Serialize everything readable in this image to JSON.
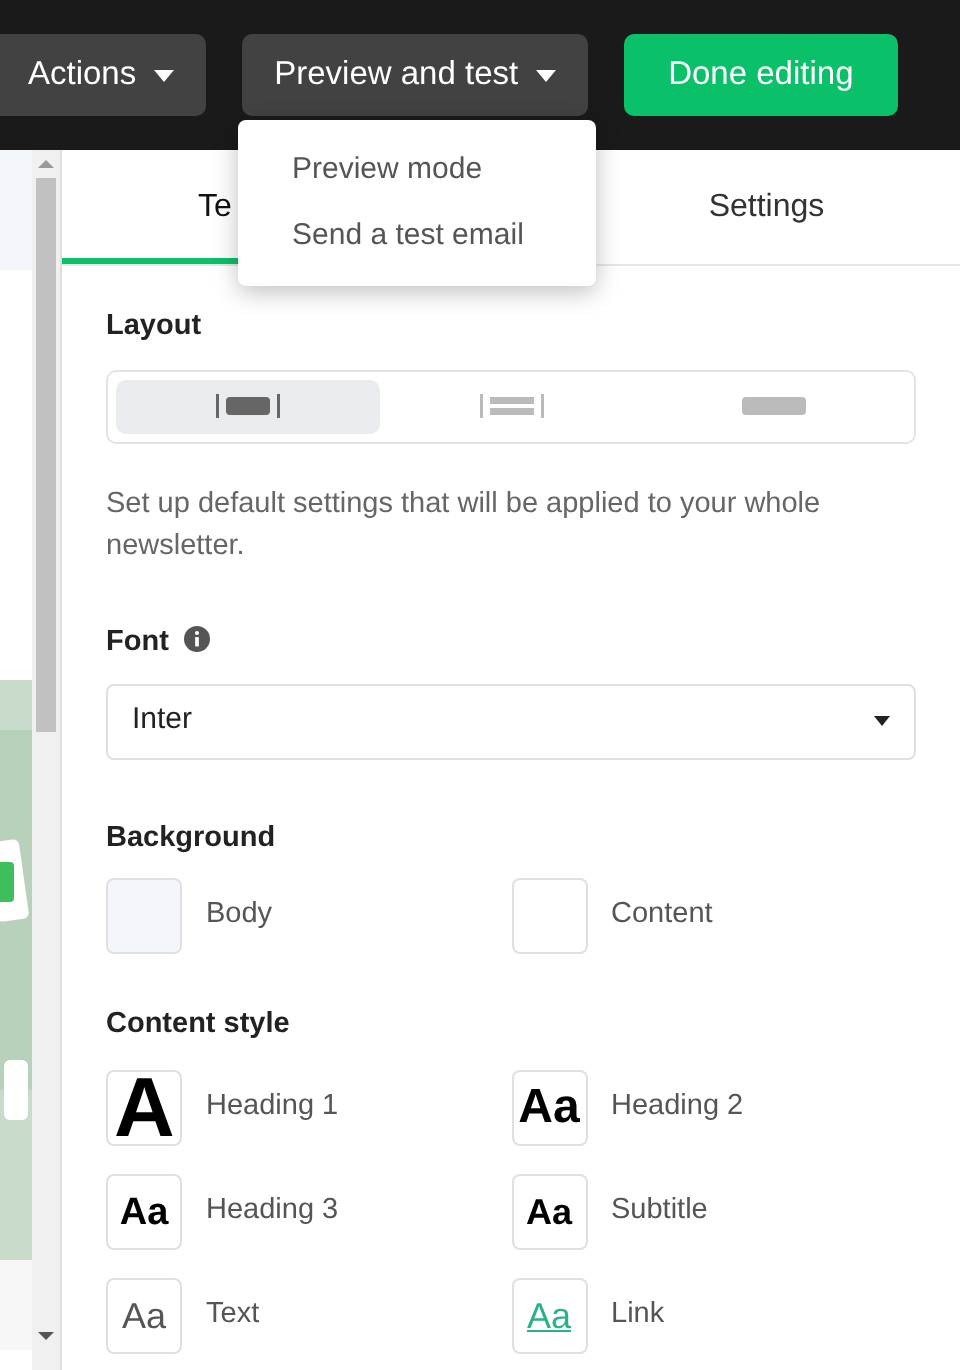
{
  "toolbar": {
    "buttons": [
      {
        "label": "Actions",
        "kind": "dark",
        "caret": true
      },
      {
        "label": "Preview and test",
        "kind": "dark",
        "caret": true
      },
      {
        "label": "Done editing",
        "kind": "primary",
        "caret": false
      }
    ]
  },
  "dropdown": {
    "items": [
      "Preview mode",
      "Send a test email"
    ]
  },
  "tabs": [
    {
      "label": "Te",
      "selected": true
    },
    {
      "label": "Settings",
      "selected": false
    }
  ],
  "layout": {
    "label": "Layout",
    "options": [
      {
        "kind": "boxed",
        "selected": true
      },
      {
        "kind": "lines",
        "selected": false
      },
      {
        "kind": "full",
        "selected": false
      }
    ]
  },
  "description": "Set up default settings that will be applied to your whole newsletter.",
  "font": {
    "label": "Font",
    "value": "Inter"
  },
  "background": {
    "label": "Background",
    "swatches": [
      {
        "label": "Body",
        "color": "#f3f6fb"
      },
      {
        "label": "Content",
        "color": "#ffffff"
      }
    ]
  },
  "content_style": {
    "label": "Content style",
    "items": [
      {
        "label": "Heading 1",
        "sample": "A",
        "kind": "h1"
      },
      {
        "label": "Heading 2",
        "sample": "Aa",
        "kind": "h2"
      },
      {
        "label": "Heading 3",
        "sample": "Aa",
        "kind": "h3"
      },
      {
        "label": "Subtitle",
        "sample": "Aa",
        "kind": "subtitle"
      },
      {
        "label": "Text",
        "sample": "Aa",
        "kind": "text"
      },
      {
        "label": "Link",
        "sample": "Aa",
        "kind": "link"
      }
    ]
  }
}
